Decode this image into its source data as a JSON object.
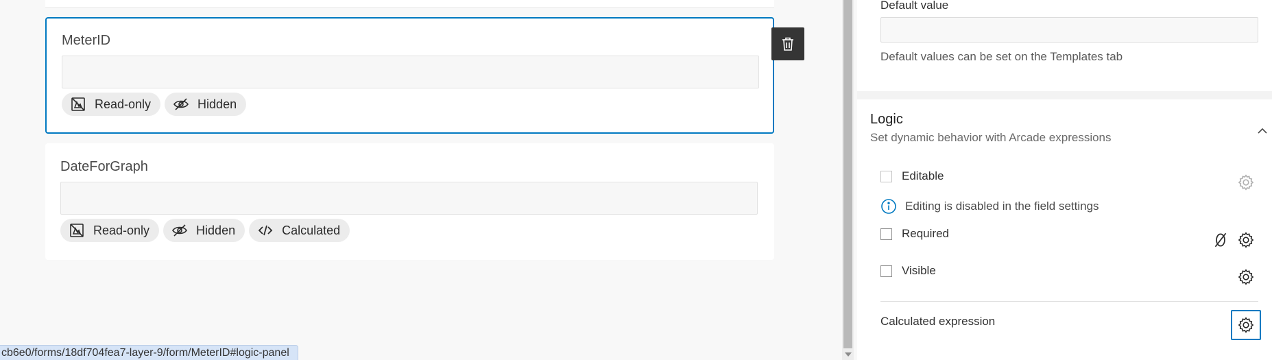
{
  "form_canvas": {
    "fields": [
      {
        "title": "MeterID",
        "chips": [
          {
            "icon": "read-only-icon",
            "label": "Read-only"
          },
          {
            "icon": "hidden-icon",
            "label": "Hidden"
          }
        ]
      },
      {
        "title": "DateForGraph",
        "chips": [
          {
            "icon": "read-only-icon",
            "label": "Read-only"
          },
          {
            "icon": "hidden-icon",
            "label": "Hidden"
          },
          {
            "icon": "code-icon",
            "label": "Calculated"
          }
        ]
      }
    ],
    "delete_icon": "trash-icon",
    "status_url": "cb6e0/forms/18df704fea7-layer-9/form/MeterID#logic-panel"
  },
  "properties_panel": {
    "default_value": {
      "label": "Default value",
      "value": "",
      "help": "Default values can be set on the Templates tab"
    },
    "logic": {
      "title": "Logic",
      "subtitle": "Set dynamic behavior with Arcade expressions",
      "editable": {
        "label": "Editable",
        "checked": false
      },
      "info": {
        "icon": "info-icon",
        "text": "Editing is disabled in the field settings"
      },
      "required": {
        "label": "Required",
        "checked": false
      },
      "visible": {
        "label": "Visible",
        "checked": false
      },
      "calculated_expression": {
        "label": "Calculated expression"
      }
    }
  },
  "colors": {
    "accent": "#0079c1",
    "chip_bg": "#ececec",
    "trash_bg": "#353535"
  }
}
